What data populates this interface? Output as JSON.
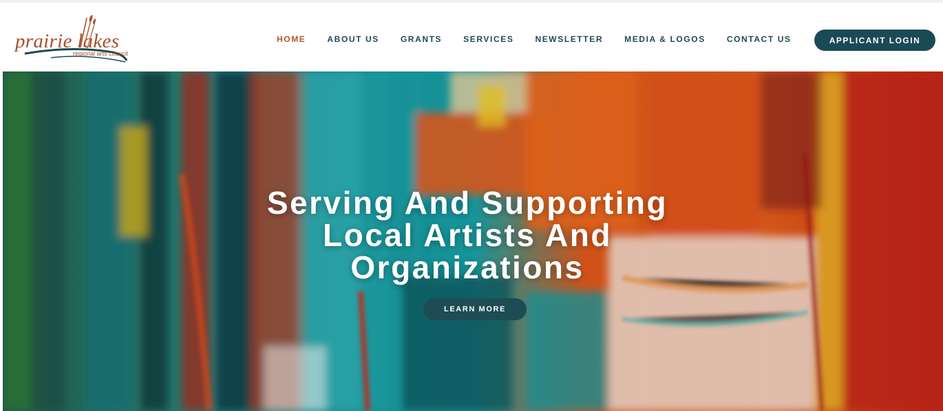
{
  "brand": {
    "logo_word": "prairie lakes",
    "logo_tagline": "regional arts council",
    "color_primary": "#1a4a56",
    "color_accent": "#b2562f"
  },
  "nav": {
    "items": [
      {
        "label": "HOME",
        "active": true
      },
      {
        "label": "ABOUT US"
      },
      {
        "label": "GRANTS"
      },
      {
        "label": "SERVICES"
      },
      {
        "label": "NEWSLETTER"
      },
      {
        "label": "MEDIA & LOGOS"
      },
      {
        "label": "CONTACT US"
      }
    ],
    "login_label": "APPLICANT LOGIN"
  },
  "hero": {
    "title_lines": [
      "Serving And Supporting",
      "Local Artists And",
      "Organizations"
    ],
    "button_label": "LEARN MORE"
  }
}
